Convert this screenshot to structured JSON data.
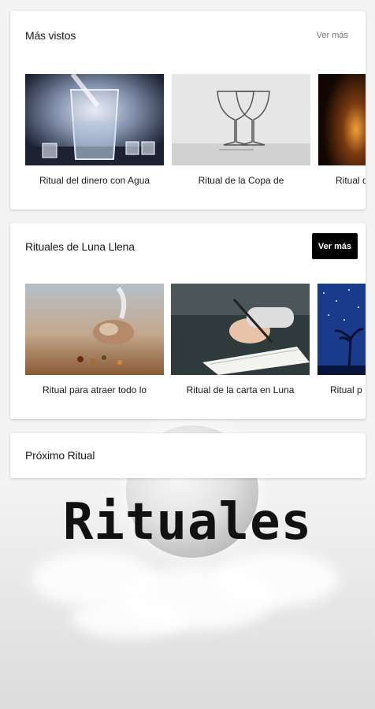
{
  "section_most_viewed": {
    "title": "Más vistos",
    "more_label": "Ver más",
    "items": [
      {
        "label": "Ritual del dinero con Agua"
      },
      {
        "label": "Ritual de la Copa de"
      },
      {
        "label": "Ritual d"
      }
    ]
  },
  "section_full_moon": {
    "title": "Rituales de Luna Llena",
    "more_label": "Ver más",
    "items": [
      {
        "label": "Ritual para atraer todo lo"
      },
      {
        "label": "Ritual de la carta en Luna"
      },
      {
        "label": "Ritual p"
      }
    ]
  },
  "section_next": {
    "title": "Próximo Ritual"
  },
  "banner": {
    "word": "Rituales"
  }
}
